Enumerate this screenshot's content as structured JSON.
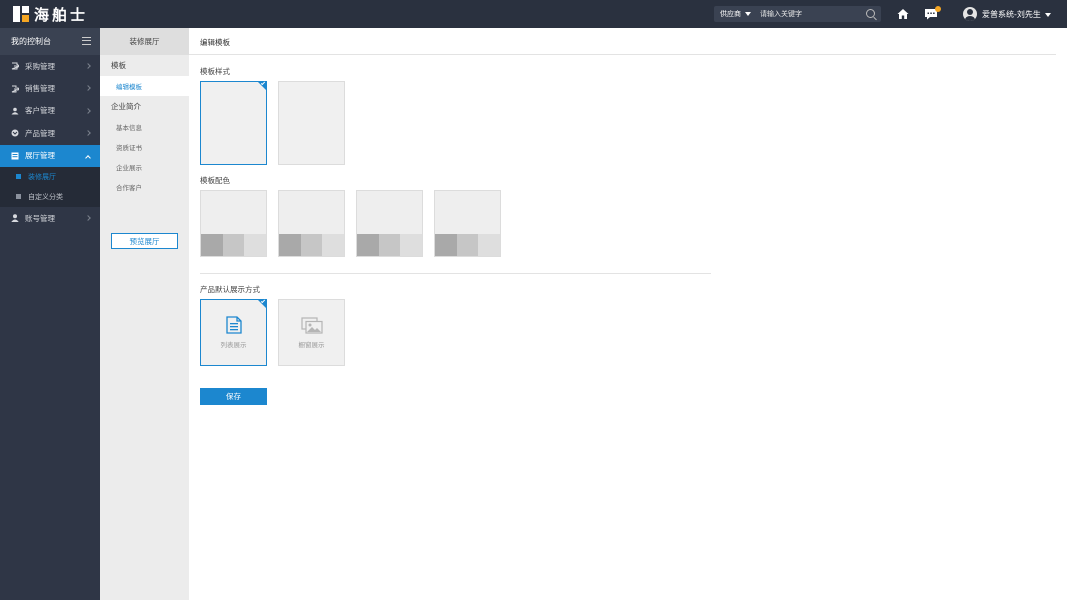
{
  "brand": {
    "name": "海舶士"
  },
  "header": {
    "search_type": "供应商",
    "search_placeholder": "请输入关键字",
    "user": "爱普系统-刘先生"
  },
  "sidebar": {
    "title": "我的控制台",
    "items": [
      {
        "label": "采购管理"
      },
      {
        "label": "销售管理"
      },
      {
        "label": "客户管理"
      },
      {
        "label": "产品管理"
      },
      {
        "label": "展厅管理"
      }
    ],
    "sub_items": [
      {
        "label": "装修展厅"
      },
      {
        "label": "自定义分类"
      }
    ],
    "after": {
      "label": "账号管理"
    }
  },
  "panel": {
    "title": "装修展厅",
    "group1": "模板",
    "group1_items": [
      "编辑模板"
    ],
    "group2": "企业简介",
    "group2_items": [
      "基本信息",
      "资质证书",
      "企业展示",
      "合作客户"
    ],
    "preview_button": "预览展厅"
  },
  "main": {
    "title": "编辑模板",
    "template_style_label": "模板样式",
    "template_color_label": "模板配色",
    "display_mode_label": "产品默认展示方式",
    "display_options": [
      "列表展示",
      "橱窗展示"
    ],
    "save_button": "保存"
  },
  "colors": {
    "accent": "#1c87cf",
    "topbar": "#2a313f",
    "sidebar": "#2f3646",
    "badge": "#f5a623",
    "swatch_bars": [
      "#a9a9a9",
      "#c6c6c6",
      "#dedede"
    ]
  }
}
